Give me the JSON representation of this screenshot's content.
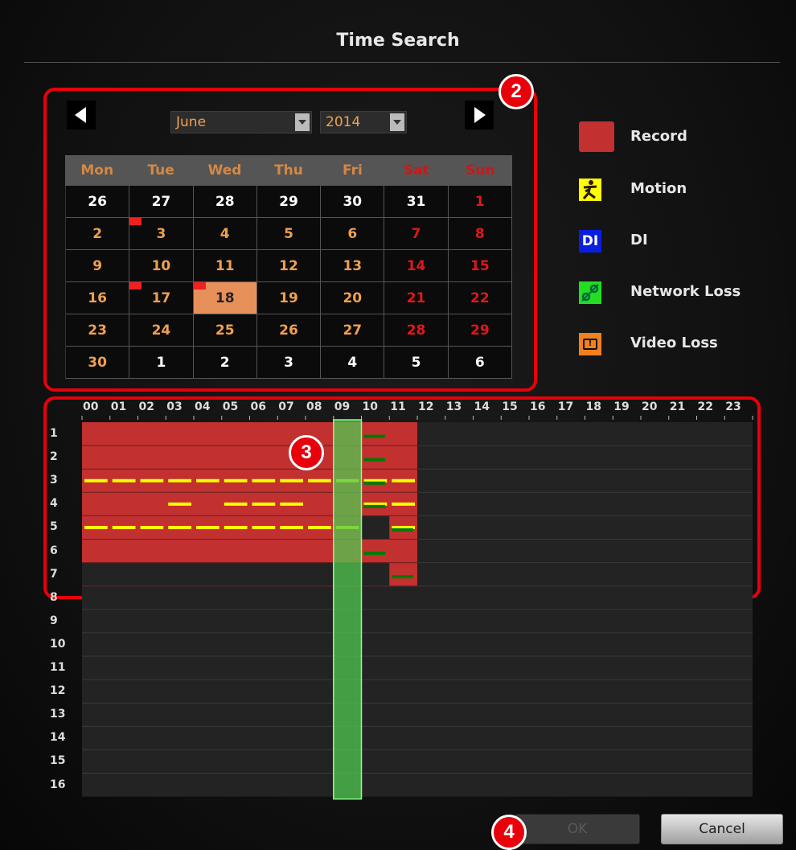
{
  "title": "Time Search",
  "calendar": {
    "month": "June",
    "year": "2014",
    "weekdays": [
      {
        "label": "Mon",
        "weekend": false
      },
      {
        "label": "Tue",
        "weekend": false
      },
      {
        "label": "Wed",
        "weekend": false
      },
      {
        "label": "Thu",
        "weekend": false
      },
      {
        "label": "Fri",
        "weekend": false
      },
      {
        "label": "Sat",
        "weekend": true
      },
      {
        "label": "Sun",
        "weekend": true
      }
    ],
    "weeks": [
      [
        {
          "d": "26",
          "c": "white"
        },
        {
          "d": "27",
          "c": "white"
        },
        {
          "d": "28",
          "c": "white"
        },
        {
          "d": "29",
          "c": "white"
        },
        {
          "d": "30",
          "c": "white"
        },
        {
          "d": "31",
          "c": "white"
        },
        {
          "d": "1",
          "c": "red"
        }
      ],
      [
        {
          "d": "2",
          "c": "orange"
        },
        {
          "d": "3",
          "c": "orange",
          "flag": true
        },
        {
          "d": "4",
          "c": "orange"
        },
        {
          "d": "5",
          "c": "orange"
        },
        {
          "d": "6",
          "c": "orange"
        },
        {
          "d": "7",
          "c": "red"
        },
        {
          "d": "8",
          "c": "red"
        }
      ],
      [
        {
          "d": "9",
          "c": "orange"
        },
        {
          "d": "10",
          "c": "orange"
        },
        {
          "d": "11",
          "c": "orange"
        },
        {
          "d": "12",
          "c": "orange"
        },
        {
          "d": "13",
          "c": "orange"
        },
        {
          "d": "14",
          "c": "red"
        },
        {
          "d": "15",
          "c": "red"
        }
      ],
      [
        {
          "d": "16",
          "c": "orange"
        },
        {
          "d": "17",
          "c": "orange",
          "flag": true
        },
        {
          "d": "18",
          "c": "orange",
          "flag": true,
          "selected": true
        },
        {
          "d": "19",
          "c": "orange"
        },
        {
          "d": "20",
          "c": "orange"
        },
        {
          "d": "21",
          "c": "red"
        },
        {
          "d": "22",
          "c": "red"
        }
      ],
      [
        {
          "d": "23",
          "c": "orange"
        },
        {
          "d": "24",
          "c": "orange"
        },
        {
          "d": "25",
          "c": "orange"
        },
        {
          "d": "26",
          "c": "orange"
        },
        {
          "d": "27",
          "c": "orange"
        },
        {
          "d": "28",
          "c": "red"
        },
        {
          "d": "29",
          "c": "red"
        }
      ],
      [
        {
          "d": "30",
          "c": "orange"
        },
        {
          "d": "1",
          "c": "white"
        },
        {
          "d": "2",
          "c": "white"
        },
        {
          "d": "3",
          "c": "white"
        },
        {
          "d": "4",
          "c": "white"
        },
        {
          "d": "5",
          "c": "white"
        },
        {
          "d": "6",
          "c": "white"
        }
      ]
    ]
  },
  "legend": [
    {
      "label": "Record",
      "icon": "record-icon"
    },
    {
      "label": "Motion",
      "icon": "motion-icon"
    },
    {
      "label": "DI",
      "icon": "di-icon",
      "icon_text": "DI"
    },
    {
      "label": "Network Loss",
      "icon": "network-loss-icon"
    },
    {
      "label": "Video Loss",
      "icon": "video-loss-icon",
      "icon_text": "!"
    }
  ],
  "timeline": {
    "hours": [
      "00",
      "01",
      "02",
      "03",
      "04",
      "05",
      "06",
      "07",
      "08",
      "09",
      "10",
      "11",
      "12",
      "13",
      "14",
      "15",
      "16",
      "17",
      "18",
      "19",
      "20",
      "21",
      "22",
      "23"
    ],
    "channels": [
      "1",
      "2",
      "3",
      "4",
      "5",
      "6",
      "7",
      "8",
      "9",
      "10",
      "11",
      "12",
      "13",
      "14",
      "15",
      "16"
    ],
    "selected_hour": "09",
    "record": [
      {
        "ch": 1,
        "start": 0,
        "end": 12
      },
      {
        "ch": 2,
        "start": 0,
        "end": 12
      },
      {
        "ch": 3,
        "start": 0,
        "end": 12
      },
      {
        "ch": 4,
        "start": 0,
        "end": 12
      },
      {
        "ch": 5,
        "start": 0,
        "end": 10
      },
      {
        "ch": 5,
        "start": 11,
        "end": 12
      },
      {
        "ch": 6,
        "start": 0,
        "end": 12
      },
      {
        "ch": 7,
        "start": 11,
        "end": 12
      }
    ],
    "motion": [
      {
        "ch": 3,
        "start": 0,
        "end": 12
      },
      {
        "ch": 4,
        "start": 3,
        "end": 4
      },
      {
        "ch": 4,
        "start": 5,
        "end": 8
      },
      {
        "ch": 4,
        "start": 10,
        "end": 12
      },
      {
        "ch": 5,
        "start": 0,
        "end": 10
      },
      {
        "ch": 5,
        "start": 11,
        "end": 12
      }
    ],
    "network_loss": [
      {
        "ch": 1,
        "start": 10,
        "end": 11
      },
      {
        "ch": 2,
        "start": 10,
        "end": 11
      },
      {
        "ch": 3,
        "start": 10,
        "end": 11
      },
      {
        "ch": 4,
        "start": 10,
        "end": 11
      },
      {
        "ch": 5,
        "start": 11,
        "end": 12
      },
      {
        "ch": 6,
        "start": 10,
        "end": 11
      },
      {
        "ch": 7,
        "start": 11,
        "end": 12
      }
    ]
  },
  "buttons": {
    "ok": "OK",
    "cancel": "Cancel"
  },
  "callouts": {
    "calendar": "2",
    "timeline": "3",
    "buttons": "4"
  },
  "colors": {
    "accent": "#e8000b",
    "record": "#c23030",
    "motion": "#ffff00",
    "network_loss": "#007a00",
    "selection": "#50c850",
    "weekend": "#e01818",
    "weekday": "#f0a050"
  }
}
